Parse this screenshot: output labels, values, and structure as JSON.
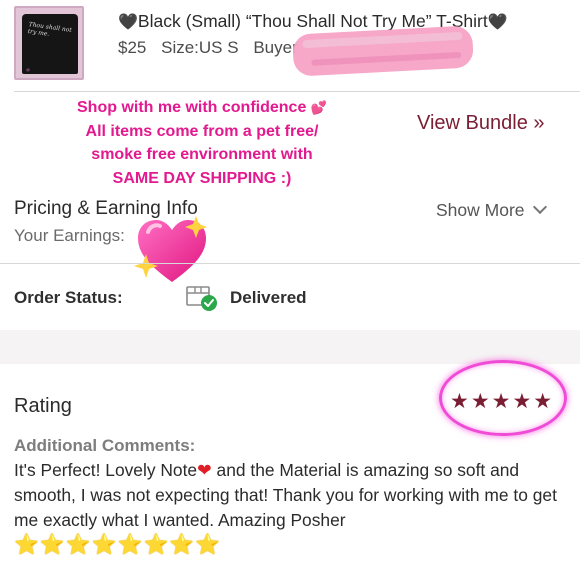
{
  "product": {
    "title_prefix_icon": "black-heart",
    "title": "Black (Small) “Thou Shall Not Try Me” T-Shirt",
    "title_suffix_icon": "black-heart",
    "price": "$25",
    "size": "Size:US S",
    "buyer_label": "Buyer",
    "thumbnail_text": "Thou shall not try me."
  },
  "promo": {
    "line1": "Shop with me with confidence",
    "line1_icon": "sparkling-heart",
    "line2": "All items come from a pet free/",
    "line3": "smoke free environment with",
    "line4": "SAME DAY SHIPPING :)",
    "color": "#e2198f"
  },
  "bundle": {
    "label": "View Bundle »",
    "color": "#7a1e34"
  },
  "pricing": {
    "title": "Pricing & Earning Info",
    "show_more": "Show More",
    "earnings_label": "Your Earnings:",
    "earnings_icon": "sparkling-heart"
  },
  "order": {
    "status_label": "Order Status:",
    "status_icon": "delivered-box-check",
    "status_value": "Delivered"
  },
  "rating": {
    "label": "Rating",
    "stars": "★★★★★",
    "star_count": 5,
    "star_color": "#7a1e34",
    "highlight_color": "#f04bd6"
  },
  "comments": {
    "label": "Additional Comments:",
    "text_part1": "It's Perfect! Lovely Note",
    "heart": "❤",
    "text_part2": " and the Material is amazing so soft and smooth, I was not expecting that! Thank you for working with me to get me exactly what I wanted. Amazing Posher",
    "stars": "⭐⭐⭐⭐⭐⭐⭐⭐"
  }
}
